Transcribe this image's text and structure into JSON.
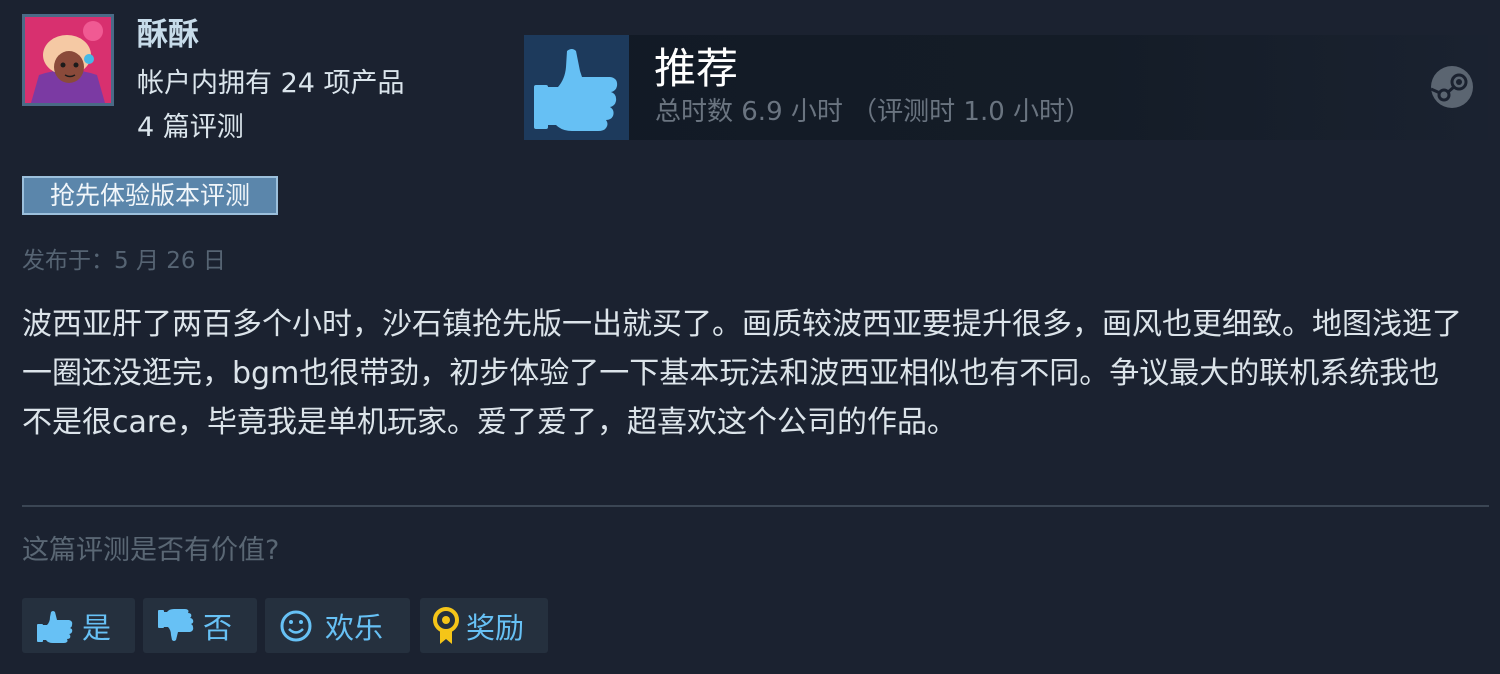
{
  "reviewer": {
    "persona_name": "酥酥",
    "products_owned": "帐户内拥有 24 项产品",
    "num_reviews": "4 篇评测"
  },
  "vote": {
    "title": "推荐",
    "hours": "总时数 6.9 小时 （评测时 1.0 小时）",
    "icon": "thumbs-up-icon"
  },
  "early_access_badge": "抢先体验版本评测",
  "posted": "发布于：5 月 26 日",
  "review_text": "波西亚肝了两百多个小时，沙石镇抢先版一出就买了。画质较波西亚要提升很多，画风也更细致。地图浅逛了一圈还没逛完，bgm也很带劲，初步体验了一下基本玩法和波西亚相似也有不同。争议最大的联机系统我也不是很care，毕竟我是单机玩家。爱了爱了，超喜欢这个公司的作品。",
  "helpful": {
    "question": "这篇评测是否有价值?",
    "yes_label": "是",
    "no_label": "否",
    "funny_label": "欢乐",
    "award_label": "奖励"
  },
  "colors": {
    "background": "#1b2230",
    "accent": "#67c1f5",
    "badge": "#5b86ab",
    "thumb_box": "#1d3a5c",
    "award": "#f5c518"
  }
}
